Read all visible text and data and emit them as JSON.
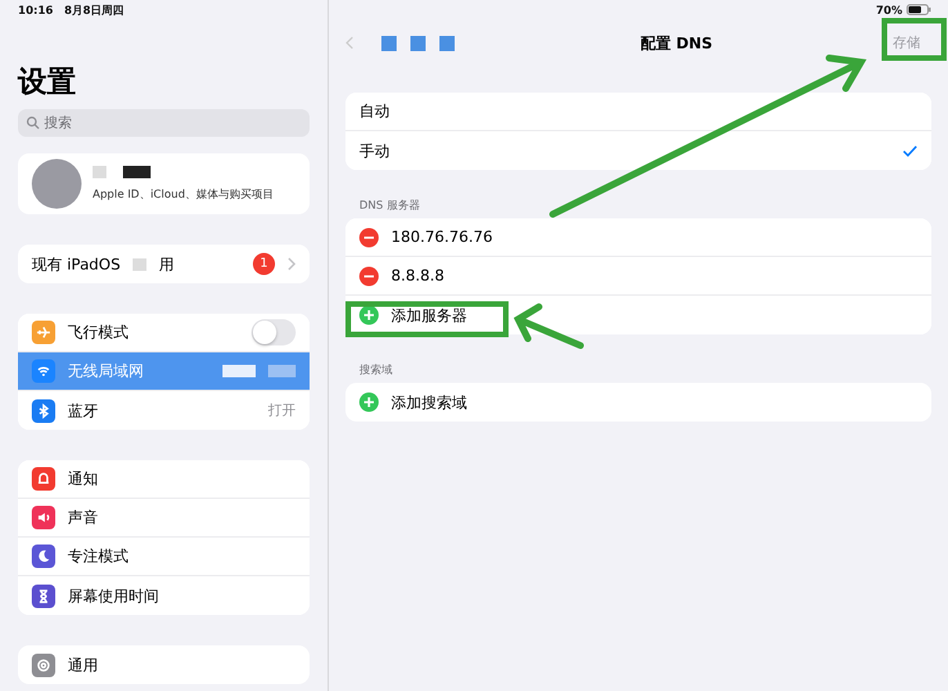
{
  "status_bar": {
    "time": "10:16",
    "date": "8月8日周四",
    "battery": "70%"
  },
  "sidebar": {
    "title": "设置",
    "search": {
      "placeholder": "搜索"
    },
    "account": {
      "subtitle": "Apple ID、iCloud、媒体与购买项目"
    },
    "update_row": {
      "label_start": "现有 iPadOS",
      "label_end": "用",
      "badge": "1"
    },
    "groups": [
      {
        "items": [
          {
            "kind": "airplane",
            "label": "飞行模式",
            "toggle": {
              "on": false
            },
            "selected": false
          },
          {
            "kind": "wifi",
            "label": "无线局域网",
            "redacted": true,
            "selected": true
          },
          {
            "kind": "bluetooth",
            "label": "蓝牙",
            "value": "打开",
            "selected": false
          }
        ]
      },
      {
        "items": [
          {
            "kind": "bell",
            "label": "通知",
            "selected": false
          },
          {
            "kind": "speaker",
            "label": "声音",
            "selected": false
          },
          {
            "kind": "moon",
            "label": "专注模式",
            "selected": false
          },
          {
            "kind": "hourglass",
            "label": "屏幕使用时间",
            "selected": false
          }
        ]
      },
      {
        "items": [
          {
            "kind": "gear",
            "label": "通用",
            "selected": false
          }
        ]
      }
    ]
  },
  "detail": {
    "title": "配置 DNS",
    "save": {
      "label": "存储",
      "disabled": true
    },
    "modes": [
      {
        "label": "自动",
        "selected": false
      },
      {
        "label": "手动",
        "selected": true
      }
    ],
    "dns_header": "DNS 服务器",
    "servers": [
      "180.76.76.76",
      "8.8.8.8"
    ],
    "add_server": "添加服务器",
    "search_header": "搜索域",
    "add_search_domain": "添加搜索域"
  }
}
